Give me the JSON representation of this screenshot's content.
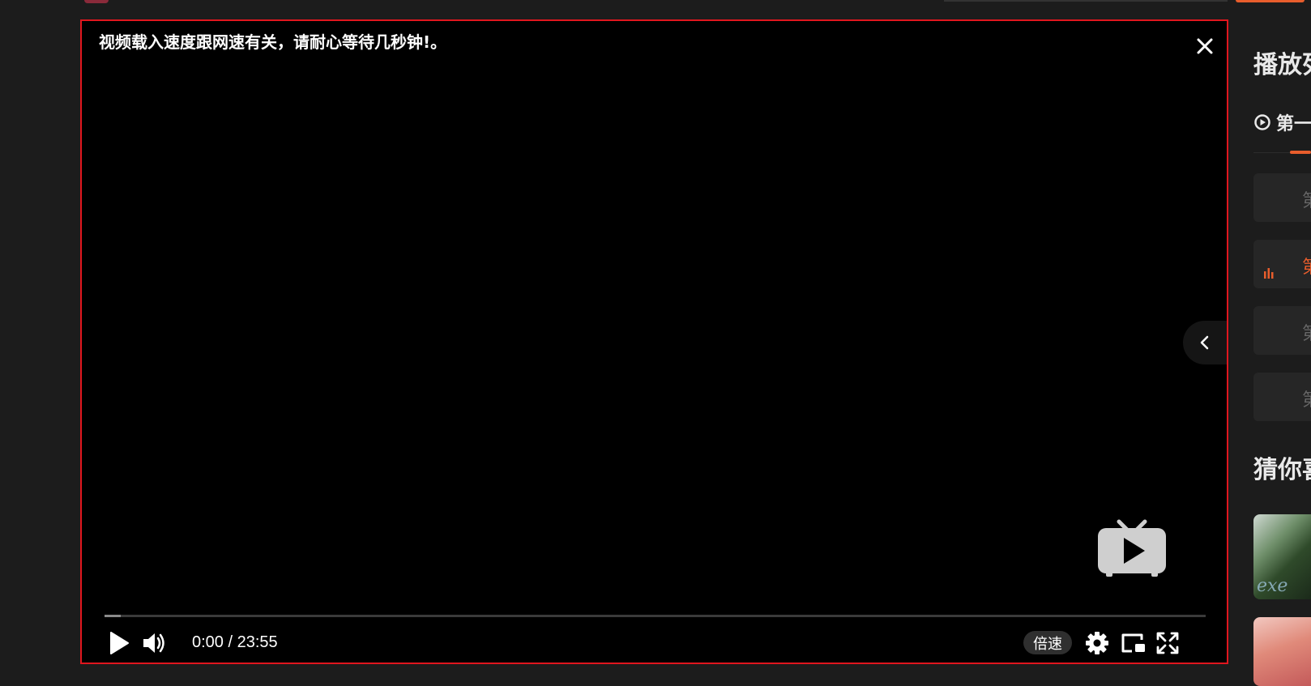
{
  "player": {
    "notice": "视频载入速度跟网速有关，请耐心等待几秒钟!。",
    "time_display": "0:00 / 23:55",
    "speed_label": "倍速",
    "progress_fraction": 0.015,
    "border_color": "#e0161e"
  },
  "icons": {
    "close": "close-icon",
    "side_toggle": "chevron-left-icon",
    "tv_logo": "tv-play-icon",
    "play": "play-icon",
    "volume": "volume-icon",
    "settings": "gear-icon",
    "pip": "picture-in-picture-icon",
    "fullscreen": "fullscreen-icon"
  },
  "sidebar": {
    "title": "播放列",
    "source_tab": "第一",
    "episodes": [
      {
        "label": "第",
        "active": false
      },
      {
        "label": "第",
        "active": true
      },
      {
        "label": "第",
        "active": false
      },
      {
        "label": "第",
        "active": false
      }
    ],
    "recommend_title": "猜你喜",
    "thumbnails": [
      {
        "overlay_text": "exe"
      },
      {
        "overlay_text": ""
      }
    ]
  },
  "colors": {
    "accent": "#e85d2c",
    "background": "#1c1c1c",
    "player_bg": "#000000"
  }
}
